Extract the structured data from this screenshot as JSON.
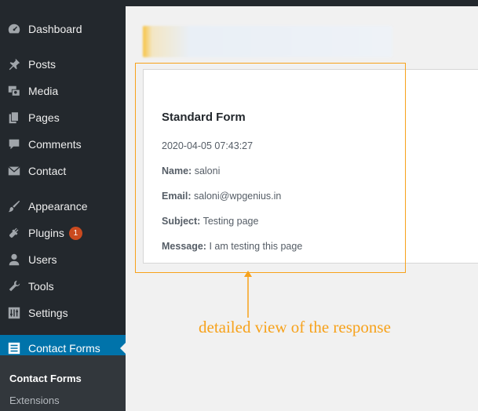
{
  "sidebar": {
    "items": [
      {
        "label": "Dashboard",
        "icon": "dashboard-icon"
      },
      {
        "label": "Posts",
        "icon": "pin-icon"
      },
      {
        "label": "Media",
        "icon": "media-icon"
      },
      {
        "label": "Pages",
        "icon": "pages-icon"
      },
      {
        "label": "Comments",
        "icon": "comment-icon"
      },
      {
        "label": "Contact",
        "icon": "envelope-icon"
      },
      {
        "label": "Appearance",
        "icon": "paintbrush-icon"
      },
      {
        "label": "Plugins",
        "icon": "plugin-icon",
        "badge": "1"
      },
      {
        "label": "Users",
        "icon": "user-icon"
      },
      {
        "label": "Tools",
        "icon": "wrench-icon"
      },
      {
        "label": "Settings",
        "icon": "settings-icon"
      },
      {
        "label": "Contact Forms",
        "icon": "forms-icon"
      }
    ],
    "submenu": [
      {
        "label": "Contact Forms"
      },
      {
        "label": "Extensions"
      }
    ],
    "colors": {
      "background": "#23282d",
      "active": "#0073aa",
      "badge": "#ca4a1f"
    }
  },
  "response": {
    "title": "Standard Form",
    "date": "2020-04-05 07:43:27",
    "name_label": "Name:",
    "name_value": "saloni",
    "email_label": "Email:",
    "email_value": "saloni@wpgenius.in",
    "subject_label": "Subject:",
    "subject_value": "Testing page",
    "message_label": "Message:",
    "message_value": "I am testing this page"
  },
  "annotation": {
    "text": "detailed view of the response",
    "color": "#f7a21b"
  }
}
